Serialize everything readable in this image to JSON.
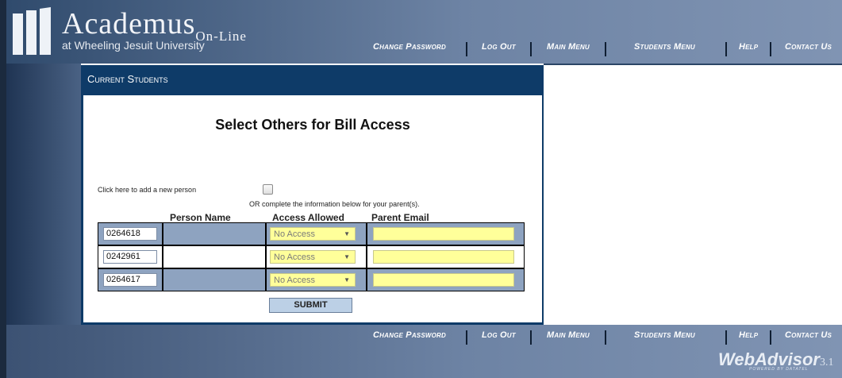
{
  "header": {
    "brand_main": "Academus",
    "brand_sub": "On-Line",
    "subtitle": "at Wheeling Jesuit University"
  },
  "nav": [
    "Change Password",
    "Log Out",
    "Main Menu",
    "Students Menu",
    "Help",
    "Contact Us"
  ],
  "section_title": "Current Students",
  "page_title": "Select Others for Bill Access",
  "add_person_label": "Click here to add a new person",
  "add_person_checked": false,
  "or_note": "OR complete the information below for your parent(s).",
  "columns": {
    "person_name": "Person Name",
    "access_allowed": "Access Allowed",
    "parent_email": "Parent Email"
  },
  "rows": [
    {
      "id": "0264618",
      "person_name": "",
      "access": "No Access",
      "email": ""
    },
    {
      "id": "0242961",
      "person_name": "",
      "access": "No Access",
      "email": ""
    },
    {
      "id": "0264617",
      "person_name": "",
      "access": "No Access",
      "email": ""
    }
  ],
  "submit_label": "SUBMIT",
  "footer_brand": {
    "name": "WebAdvisor",
    "version": "3.1",
    "powered": "POWERED BY DATATEL"
  },
  "colors": {
    "title_bar": "#0e3b68",
    "input_highlight": "#ffff9a",
    "row_shade": "#8ea3c0"
  }
}
